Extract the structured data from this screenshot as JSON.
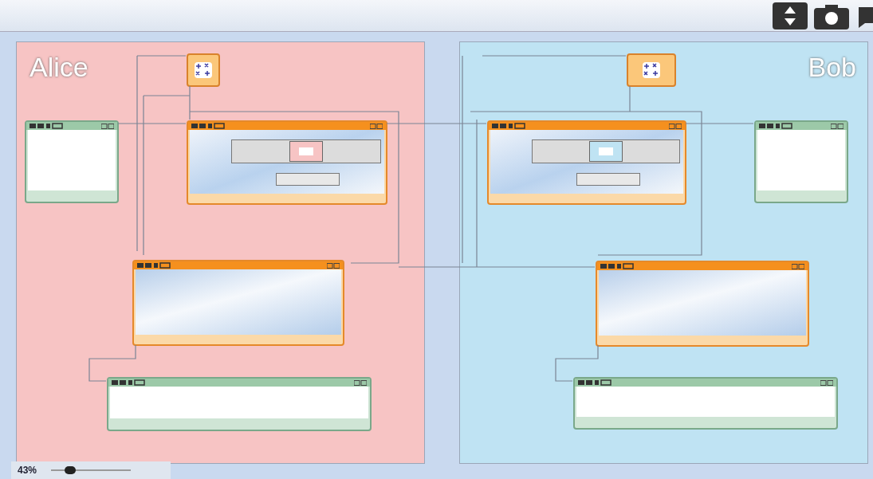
{
  "lanes": [
    {
      "label": "Alice",
      "color": "#f7c4c4",
      "nodes": [
        {
          "kind": "control"
        },
        {
          "kind": "display"
        },
        {
          "kind": "form"
        },
        {
          "kind": "view"
        },
        {
          "kind": "wide-display"
        }
      ]
    },
    {
      "label": "Bob",
      "color": "#bfe3f3",
      "nodes": [
        {
          "kind": "control"
        },
        {
          "kind": "form"
        },
        {
          "kind": "display"
        },
        {
          "kind": "view"
        },
        {
          "kind": "wide-display"
        }
      ]
    }
  ],
  "zoom": {
    "label": "43%",
    "level": 0.2
  }
}
